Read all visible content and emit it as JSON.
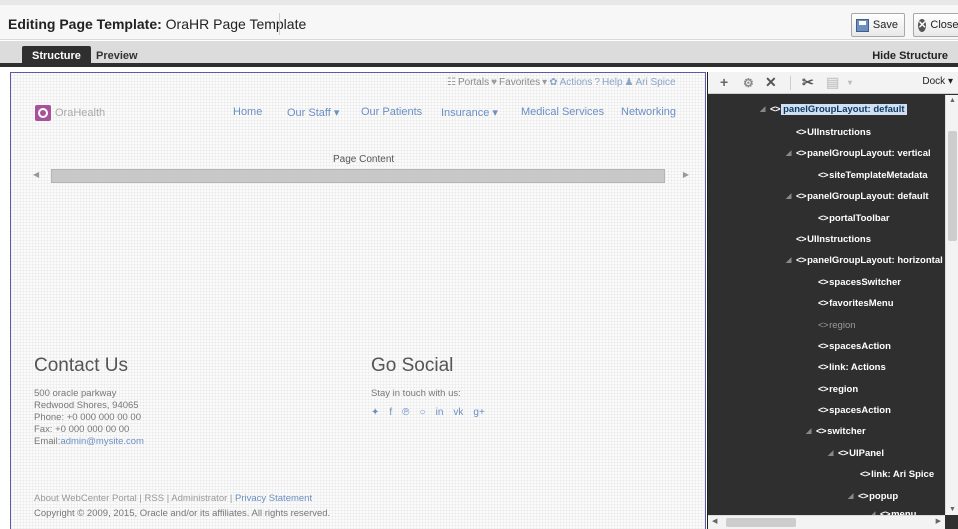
{
  "header": {
    "title_prefix": "Editing Page Template:",
    "title_value": "OraHR Page Template",
    "save_label": "Save",
    "close_label": "Close"
  },
  "tabs": {
    "structure": "Structure",
    "preview": "Preview",
    "hide_structure": "Hide Structure"
  },
  "utility_bar": {
    "portals": "Portals",
    "favorites": "Favorites",
    "actions": "Actions",
    "help": "Help",
    "user": "Ari Spice"
  },
  "site": {
    "logo_text": "OraHealth",
    "nav": [
      "Home",
      "Our Staff ▾",
      "Our Patients",
      "Insurance ▾",
      "Medical Services",
      "Networking"
    ],
    "page_content_label": "Page Content"
  },
  "contact": {
    "title": "Contact Us",
    "address1": "500 oracle parkway",
    "address2": "Redwood Shores, 94065",
    "phone": "Phone: +0 000 000 00 00",
    "fax": "Fax: +0 000 000 00 00",
    "email_label": "Email:",
    "email": "admin@mysite.com"
  },
  "social": {
    "title": "Go Social",
    "subtitle": "Stay in touch with us:",
    "icons": [
      "twitter-icon",
      "facebook-icon",
      "pinterest-icon",
      "github-icon",
      "linkedin-icon",
      "vk-icon",
      "google-plus-icon"
    ]
  },
  "footer": {
    "links": "About WebCenter Portal | RSS | Administrator |",
    "privacy": "Privacy Statement",
    "copyright": "Copyright © 2009, 2015, Oracle and/or its affiliates. All rights reserved."
  },
  "structure_panel": {
    "dock_label": "Dock",
    "nodes": [
      "panelGroupLayout: default",
      "UIInstructions",
      "panelGroupLayout: vertical",
      "siteTemplateMetadata",
      "panelGroupLayout: default",
      "portalToolbar",
      "UIInstructions",
      "panelGroupLayout: horizontal",
      "spacesSwitcher",
      "favoritesMenu",
      "region",
      "spacesAction",
      "link: Actions",
      "region",
      "spacesAction",
      "switcher",
      "UIPanel",
      "link: Ari Spice",
      "popup",
      "menu"
    ]
  }
}
